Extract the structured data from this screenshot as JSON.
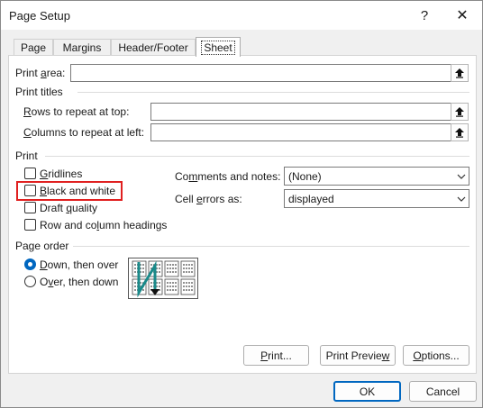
{
  "window": {
    "title": "Page Setup",
    "help": "?",
    "close": "✕"
  },
  "tabs": [
    "Page",
    "Margins",
    "Header/Footer",
    "Sheet"
  ],
  "print_area": {
    "label_pre": "Print ",
    "label_u": "a",
    "label_post": "rea:",
    "value": ""
  },
  "print_titles": {
    "heading": "Print titles",
    "rows": {
      "label_u": "R",
      "label_post": "ows to repeat at top:",
      "value": ""
    },
    "cols": {
      "label_u": "C",
      "label_post": "olumns to repeat at left:",
      "value": ""
    }
  },
  "print": {
    "heading": "Print",
    "gridlines": {
      "label_u": "G",
      "label_post": "ridlines",
      "checked": false
    },
    "black_white": {
      "label_u": "B",
      "label_post": "lack and white",
      "checked": false
    },
    "draft": {
      "label_pre": "Draft ",
      "label_u": "q",
      "label_post": "uality",
      "checked": false
    },
    "headings": {
      "label_pre": "Row and co",
      "label_u": "l",
      "label_post": "umn headings",
      "checked": false
    },
    "comments": {
      "label_pre": "Co",
      "label_u": "m",
      "label_post": "ments and notes:",
      "value": "(None)"
    },
    "errors": {
      "label_pre": "Cell ",
      "label_u": "e",
      "label_post": "rrors as:",
      "value": "displayed"
    }
  },
  "page_order": {
    "heading": "Page order",
    "down": {
      "label_u": "D",
      "label_post": "own, then over",
      "selected": true
    },
    "over": {
      "label_pre": "O",
      "label_u": "v",
      "label_post": "er, then down",
      "selected": false
    }
  },
  "buttons": {
    "print_pre": "",
    "print_u": "P",
    "print_post": "rint...",
    "preview_pre": "Print Previe",
    "preview_u": "w",
    "preview_post": "",
    "options_pre": "",
    "options_u": "O",
    "options_post": "ptions...",
    "ok": "OK",
    "cancel": "Cancel"
  },
  "colors": {
    "accent": "#0067c0",
    "highlight": "#e02020",
    "arrow": "#1a8a8a"
  }
}
